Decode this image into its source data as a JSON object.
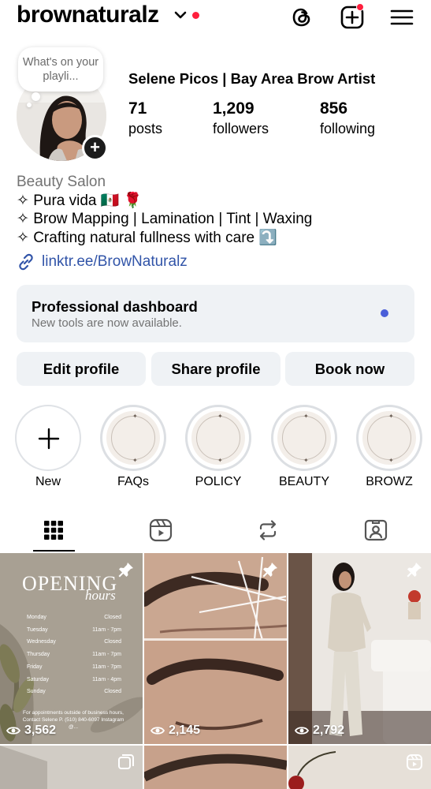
{
  "header": {
    "username": "brownaturalz",
    "icons": [
      "chevron-down-icon",
      "threads-icon",
      "new-post-icon",
      "menu-icon"
    ]
  },
  "profile": {
    "note": "What's on your playli...",
    "display_name": "Selene Picos | Bay Area Brow Artist",
    "stats": [
      {
        "value": "71",
        "label": "posts"
      },
      {
        "value": "1,209",
        "label": "followers"
      },
      {
        "value": "856",
        "label": "following"
      }
    ],
    "category": "Beauty Salon",
    "bio_lines": [
      "✧ Pura vida 🇲🇽 🌹",
      "✧ Brow Mapping | Lamination | Tint | Waxing",
      "✧ Crafting natural fullness with care ⤵️"
    ],
    "link": "linktr.ee/BrowNaturalz"
  },
  "dashboard": {
    "title": "Professional dashboard",
    "subtitle": "New tools are now available."
  },
  "buttons": {
    "edit": "Edit profile",
    "share": "Share profile",
    "book": "Book now"
  },
  "highlights": [
    {
      "label": "New"
    },
    {
      "label": "FAQs"
    },
    {
      "label": "POLICY"
    },
    {
      "label": "BEAUTY"
    },
    {
      "label": "BROWZ"
    }
  ],
  "tabs": [
    "grid-icon",
    "reels-icon",
    "reposts-icon",
    "tagged-icon"
  ],
  "posts": [
    {
      "views": "3,562",
      "pinned": true,
      "overlay_title": "OPENING",
      "overlay_subtitle": "hours",
      "schedule": [
        {
          "day": "Monday",
          "hours": "Closed"
        },
        {
          "day": "Tuesday",
          "hours": "11am - 7pm"
        },
        {
          "day": "Wednesday",
          "hours": "Closed"
        },
        {
          "day": "Thursday",
          "hours": "11am - 7pm"
        },
        {
          "day": "Friday",
          "hours": "11am - 7pm"
        },
        {
          "day": "Saturday",
          "hours": "11am - 4pm"
        },
        {
          "day": "Sunday",
          "hours": "Closed"
        }
      ],
      "footer": "For appointments outside of business hours, Contact Selene P. (510) 840-6097 Instagram @..."
    },
    {
      "views": "2,145",
      "pinned": true
    },
    {
      "views": "2,792",
      "pinned": true
    }
  ],
  "colors": {
    "accent_red": "#ff1f3d",
    "link_blue": "#3154a8",
    "button_bg": "#eff2f5",
    "dashboard_dot": "#4a5fd9"
  }
}
